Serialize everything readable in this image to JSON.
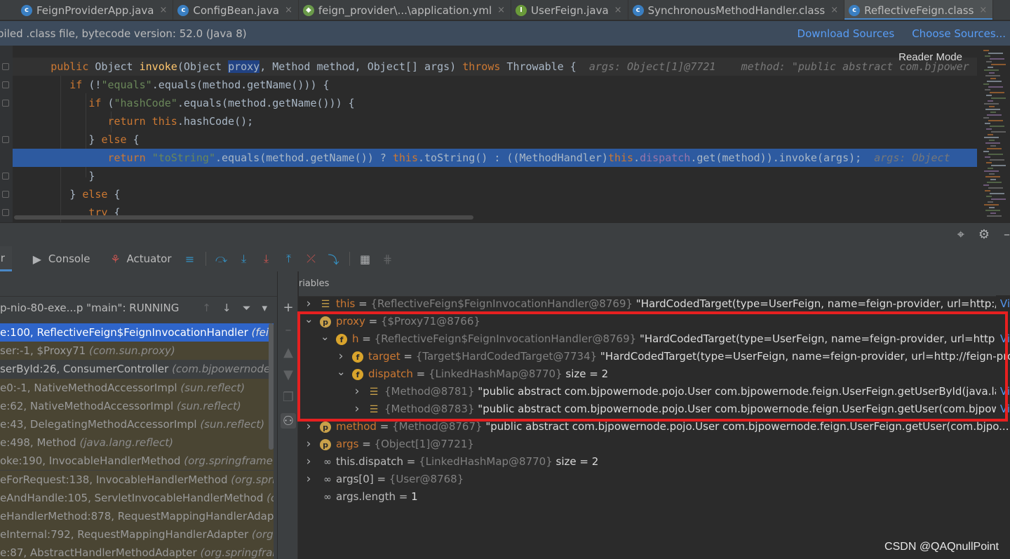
{
  "tabs": [
    {
      "label": "FeignProviderApp.java",
      "icon": "class-icon",
      "color": "#3a7fc2"
    },
    {
      "label": "ConfigBean.java",
      "icon": "class-icon",
      "color": "#3a7fc2"
    },
    {
      "label": "feign_provider\\...\\application.yml",
      "icon": "yaml-icon",
      "color": "#6a9a4a"
    },
    {
      "label": "UserFeign.java",
      "icon": "interface-icon",
      "color": "#6a9a3a"
    },
    {
      "label": "SynchronousMethodHandler.class",
      "icon": "class-icon",
      "color": "#3a7fc2"
    },
    {
      "label": "ReflectiveFeign.class",
      "icon": "class-icon",
      "color": "#3a7fc2"
    }
  ],
  "banner": {
    "message": "piled .class file, bytecode version: 52.0 (Java 8)",
    "download_sources": "Download Sources",
    "choose_sources": "Choose Sources..."
  },
  "editor": {
    "reader_mode": "Reader Mode",
    "hint_args": "args: Object[1]@7721",
    "hint_method": "method: \"public abstract com.bjpower",
    "hint_exec": "args: Object"
  },
  "debug": {
    "debugger_tab": "ger",
    "console_tab": "Console",
    "actuator_tab": "Actuator",
    "variables_label": "Variables",
    "thread": "p-nio-80-exe...p \"main\": RUNNING"
  },
  "frames": [
    {
      "text": "e:100, ReflectiveFeign$FeignInvocationHandler",
      "pkg": "(feign)",
      "style": "sel"
    },
    {
      "text": "ser:-1, $Proxy71",
      "pkg": "(com.sun.proxy)",
      "style": "lib"
    },
    {
      "text": "serById:26, ConsumerController",
      "pkg": "(com.bjpowernode.co",
      "style": "normal"
    },
    {
      "text": "e0:-1, NativeMethodAccessorImpl",
      "pkg": "(sun.reflect)",
      "style": "lib"
    },
    {
      "text": "e:62, NativeMethodAccessorImpl",
      "pkg": "(sun.reflect)",
      "style": "lib"
    },
    {
      "text": "e:43, DelegatingMethodAccessorImpl",
      "pkg": "(sun.reflect)",
      "style": "lib"
    },
    {
      "text": "e:498, Method",
      "pkg": "(java.lang.reflect)",
      "style": "lib"
    },
    {
      "text": "oke:190, InvocableHandlerMethod",
      "pkg": "(org.springframew",
      "style": "lib"
    },
    {
      "text": "eForRequest:138, InvocableHandlerMethod",
      "pkg": "(org.sprin",
      "style": "lib"
    },
    {
      "text": "eAndHandle:105, ServletInvocableHandlerMethod",
      "pkg": "(or",
      "style": "lib"
    },
    {
      "text": "eHandlerMethod:878, RequestMappingHandlerAdapt",
      "pkg": "",
      "style": "lib"
    },
    {
      "text": "eInternal:792, RequestMappingHandlerAdapter",
      "pkg": "(org.s",
      "style": "lib"
    },
    {
      "text": "e:87, AbstractHandlerMethodAdapter",
      "pkg": "(org.springfram",
      "style": "lib"
    }
  ],
  "variables": [
    {
      "name": "this",
      "eq": " = ",
      "type": "{ReflectiveFeign$FeignInvocationHandler@8769}",
      "value": " \"HardCodedTarget(type=UserFeign, name=feign-provider, url=http://fe...",
      "link": "Vi",
      "icon": "list",
      "arrow": "right",
      "indent": 0,
      "nameStyle": "obj"
    },
    {
      "name": "proxy",
      "eq": " = ",
      "type": "{$Proxy71@8766}",
      "value": "",
      "link": "",
      "icon": "p",
      "arrow": "down",
      "indent": 0,
      "nameStyle": "obj"
    },
    {
      "name": "h",
      "eq": " = ",
      "type": "{ReflectiveFeign$FeignInvocationHandler@8769}",
      "value": " \"HardCodedTarget(type=UserFeign, name=feign-provider, url=http://f...",
      "link": "Vi",
      "icon": "f",
      "arrow": "down",
      "indent": 1,
      "nameStyle": "obj"
    },
    {
      "name": "target",
      "eq": " = ",
      "type": "{Target$HardCodedTarget@7734}",
      "value": " \"HardCodedTarget(type=UserFeign, name=feign-provider, url=http://feign-provi",
      "link": "",
      "icon": "f",
      "arrow": "right",
      "indent": 2,
      "nameStyle": "obj"
    },
    {
      "name": "dispatch",
      "eq": " = ",
      "type": "{LinkedHashMap@8770}",
      "value": "  size = 2",
      "link": "",
      "icon": "f",
      "arrow": "down",
      "indent": 2,
      "nameStyle": "obj"
    },
    {
      "name": "",
      "eq": "",
      "type": "{Method@8781}",
      "value": " \"public abstract com.bjpowernode.pojo.User com.bjpowernode.feign.UserFeign.getUserById(java.lan...",
      "link": "Vi",
      "icon": "list",
      "arrow": "right",
      "indent": 3,
      "nameStyle": "obj"
    },
    {
      "name": "",
      "eq": "",
      "type": "{Method@8783}",
      "value": " \"public abstract com.bjpowernode.pojo.User com.bjpowernode.feign.UserFeign.getUser(com.bjpow...",
      "link": "Vi",
      "icon": "list",
      "arrow": "right",
      "indent": 3,
      "nameStyle": "obj"
    },
    {
      "name": "method",
      "eq": " = ",
      "type": "{Method@8767}",
      "value": " \"public abstract com.bjpowernode.pojo.User com.bjpowernode.feign.UserFeign.getUser(com.bjpo...",
      "link": "",
      "icon": "p",
      "arrow": "right",
      "indent": 0,
      "nameStyle": "obj"
    },
    {
      "name": "args",
      "eq": " = ",
      "type": "{Object[1]@7721}",
      "value": "",
      "link": "",
      "icon": "p",
      "arrow": "right",
      "indent": 0,
      "nameStyle": "obj"
    },
    {
      "name": "this.dispatch",
      "eq": " = ",
      "type": "{LinkedHashMap@8770}",
      "value": "  size = 2",
      "link": "",
      "icon": "glass",
      "arrow": "right",
      "indent": 0,
      "nameStyle": "obj"
    },
    {
      "name": "args[0]",
      "eq": " = ",
      "type": "{User@8768}",
      "value": "",
      "link": "",
      "icon": "glass",
      "arrow": "right",
      "indent": 0,
      "nameStyle": "obj"
    },
    {
      "name": "args.length",
      "eq": " = ",
      "type": "",
      "value": "1",
      "link": "",
      "icon": "glass",
      "arrow": "none",
      "indent": 0,
      "nameStyle": "obj"
    }
  ],
  "watermark": "CSDN @QAQnullPoint"
}
